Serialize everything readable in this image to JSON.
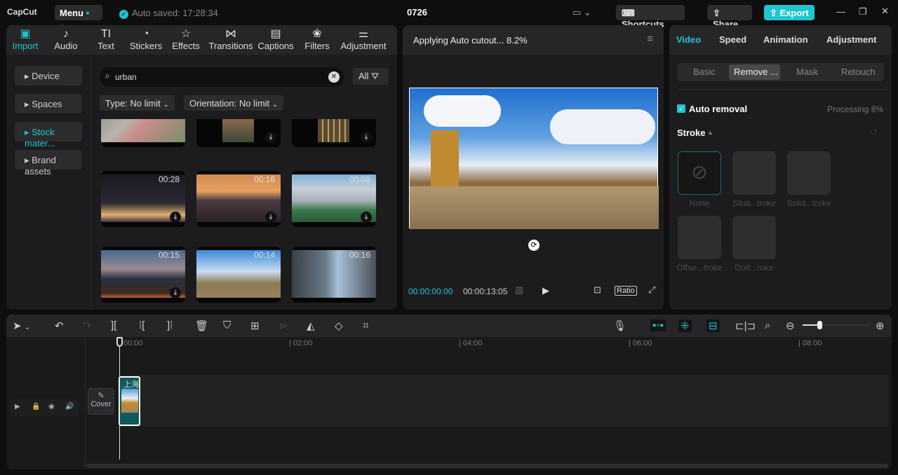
{
  "app": {
    "logo": "CapCut",
    "menu": "Menu",
    "autosave": "Auto saved: 17:28:34",
    "project_title": "0726",
    "shortcuts": "Shortcuts",
    "share": "Share",
    "export": "Export",
    "accent": "#20c5d0"
  },
  "media_tabs": [
    {
      "label": "Import",
      "icon": "import-icon",
      "active": true
    },
    {
      "label": "Audio",
      "icon": "audio-icon"
    },
    {
      "label": "Text",
      "icon": "text-icon"
    },
    {
      "label": "Stickers",
      "icon": "stickers-icon"
    },
    {
      "label": "Effects",
      "icon": "effects-icon"
    },
    {
      "label": "Transitions",
      "icon": "transitions-icon"
    },
    {
      "label": "Captions",
      "icon": "captions-icon"
    },
    {
      "label": "Filters",
      "icon": "filters-icon"
    },
    {
      "label": "Adjustment",
      "icon": "adjustment-icon"
    }
  ],
  "sidebar": [
    {
      "label": "Device"
    },
    {
      "label": "Spaces"
    },
    {
      "label": "Stock mater...",
      "active": true
    },
    {
      "label": "Brand assets"
    }
  ],
  "search": {
    "value": "urban",
    "all": "All"
  },
  "filters": {
    "type": "Type: No limit",
    "orientation": "Orientation: No limit"
  },
  "thumbs": [
    {
      "duration": ""
    },
    {
      "duration": ""
    },
    {
      "duration": ""
    },
    {
      "duration": "00:28"
    },
    {
      "duration": "00:16"
    },
    {
      "duration": "00:08"
    },
    {
      "duration": "00:15"
    },
    {
      "duration": "00:14"
    },
    {
      "duration": "00:16"
    }
  ],
  "preview": {
    "status": "Applying Auto cutout... 8.2%",
    "current": "00:00:00:00",
    "total": "00:00:13:05",
    "ratio": "Ratio"
  },
  "right": {
    "tabs": [
      "Video",
      "Speed",
      "Animation",
      "Adjustment"
    ],
    "subtabs": [
      "Basic",
      "Remove ...",
      "Mask",
      "Retouch"
    ],
    "auto_removal": "Auto removal",
    "auto_removal_checked": true,
    "processing": "Processing 8%",
    "stroke": "Stroke",
    "strokes": [
      "None",
      "Strai...troke",
      "Solid...troke",
      "Offse...troke",
      "Dott...roke"
    ]
  },
  "timeline": {
    "ticks": [
      "00:00",
      "02:00",
      "04:00",
      "06:00",
      "08:00"
    ],
    "cover": "Cover",
    "clip_label": "上海",
    "zoom_level": 0.25
  }
}
